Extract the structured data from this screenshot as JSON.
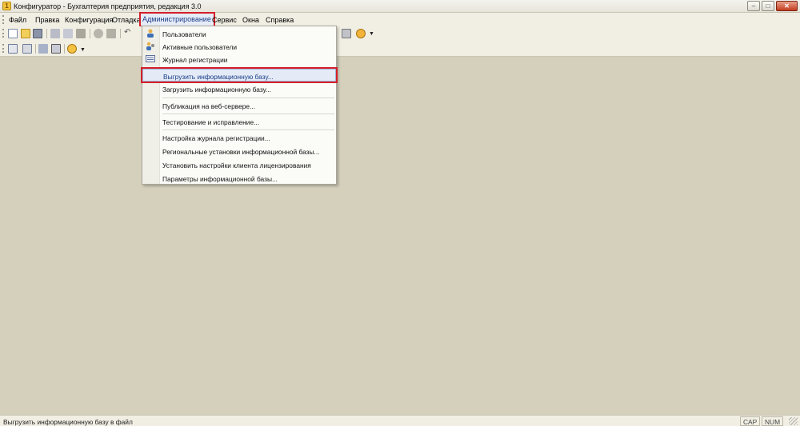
{
  "window": {
    "title": "Конфигуратор - Бухгалтерия предприятия, редакция 3.0",
    "title_ghost": "",
    "controls": {
      "minimize": "–",
      "maximize": "□",
      "close": "✕"
    }
  },
  "menubar": {
    "items": [
      {
        "label": "Файл"
      },
      {
        "label": "Правка"
      },
      {
        "label": "Конфигурация"
      },
      {
        "label": "Отладка"
      },
      {
        "label": "Администрирование",
        "active": true
      },
      {
        "label": "Сервис"
      },
      {
        "label": "Окна"
      },
      {
        "label": "Справка"
      }
    ]
  },
  "admin_menu": {
    "items": [
      {
        "label": "Пользователи",
        "icon": "user-icon"
      },
      {
        "label": "Активные пользователи",
        "icon": "active-users-icon"
      },
      {
        "label": "Журнал регистрации",
        "icon": "event-log-icon"
      },
      {
        "label": "Выгрузить информационную базу...",
        "icon": "",
        "highlighted": true
      },
      {
        "label": "Загрузить информационную базу...",
        "icon": ""
      },
      {
        "label": "Публикация на веб-сервере...",
        "icon": ""
      },
      {
        "label": "Тестирование и исправление...",
        "icon": ""
      },
      {
        "label": "Настройка журнала регистрации...",
        "icon": ""
      },
      {
        "label": "Региональные установки информационной базы...",
        "icon": ""
      },
      {
        "label": "Установить настройки клиента лицензирования",
        "icon": ""
      },
      {
        "label": "Параметры информационной базы...",
        "icon": ""
      }
    ]
  },
  "toolbar": {
    "icons": [
      "new-file-icon",
      "open-folder-icon",
      "save-icon",
      "cut-icon",
      "copy-icon",
      "paste-icon",
      "print-icon",
      "find-icon",
      "undo-icon",
      "redo-icon",
      "reports-icon",
      "info-icon"
    ],
    "icons_row2": [
      "config-tree-icon",
      "document-icon",
      "compare-icon",
      "window-icon",
      "run-debug-icon"
    ]
  },
  "statusbar": {
    "text": "Выгрузить информационную базу в файл",
    "cap": "CAP",
    "num": "NUM"
  },
  "colors": {
    "accent_red": "#d4202a",
    "workspace": "#d4d0bc",
    "menu_highlight": "#e4ebf7"
  }
}
